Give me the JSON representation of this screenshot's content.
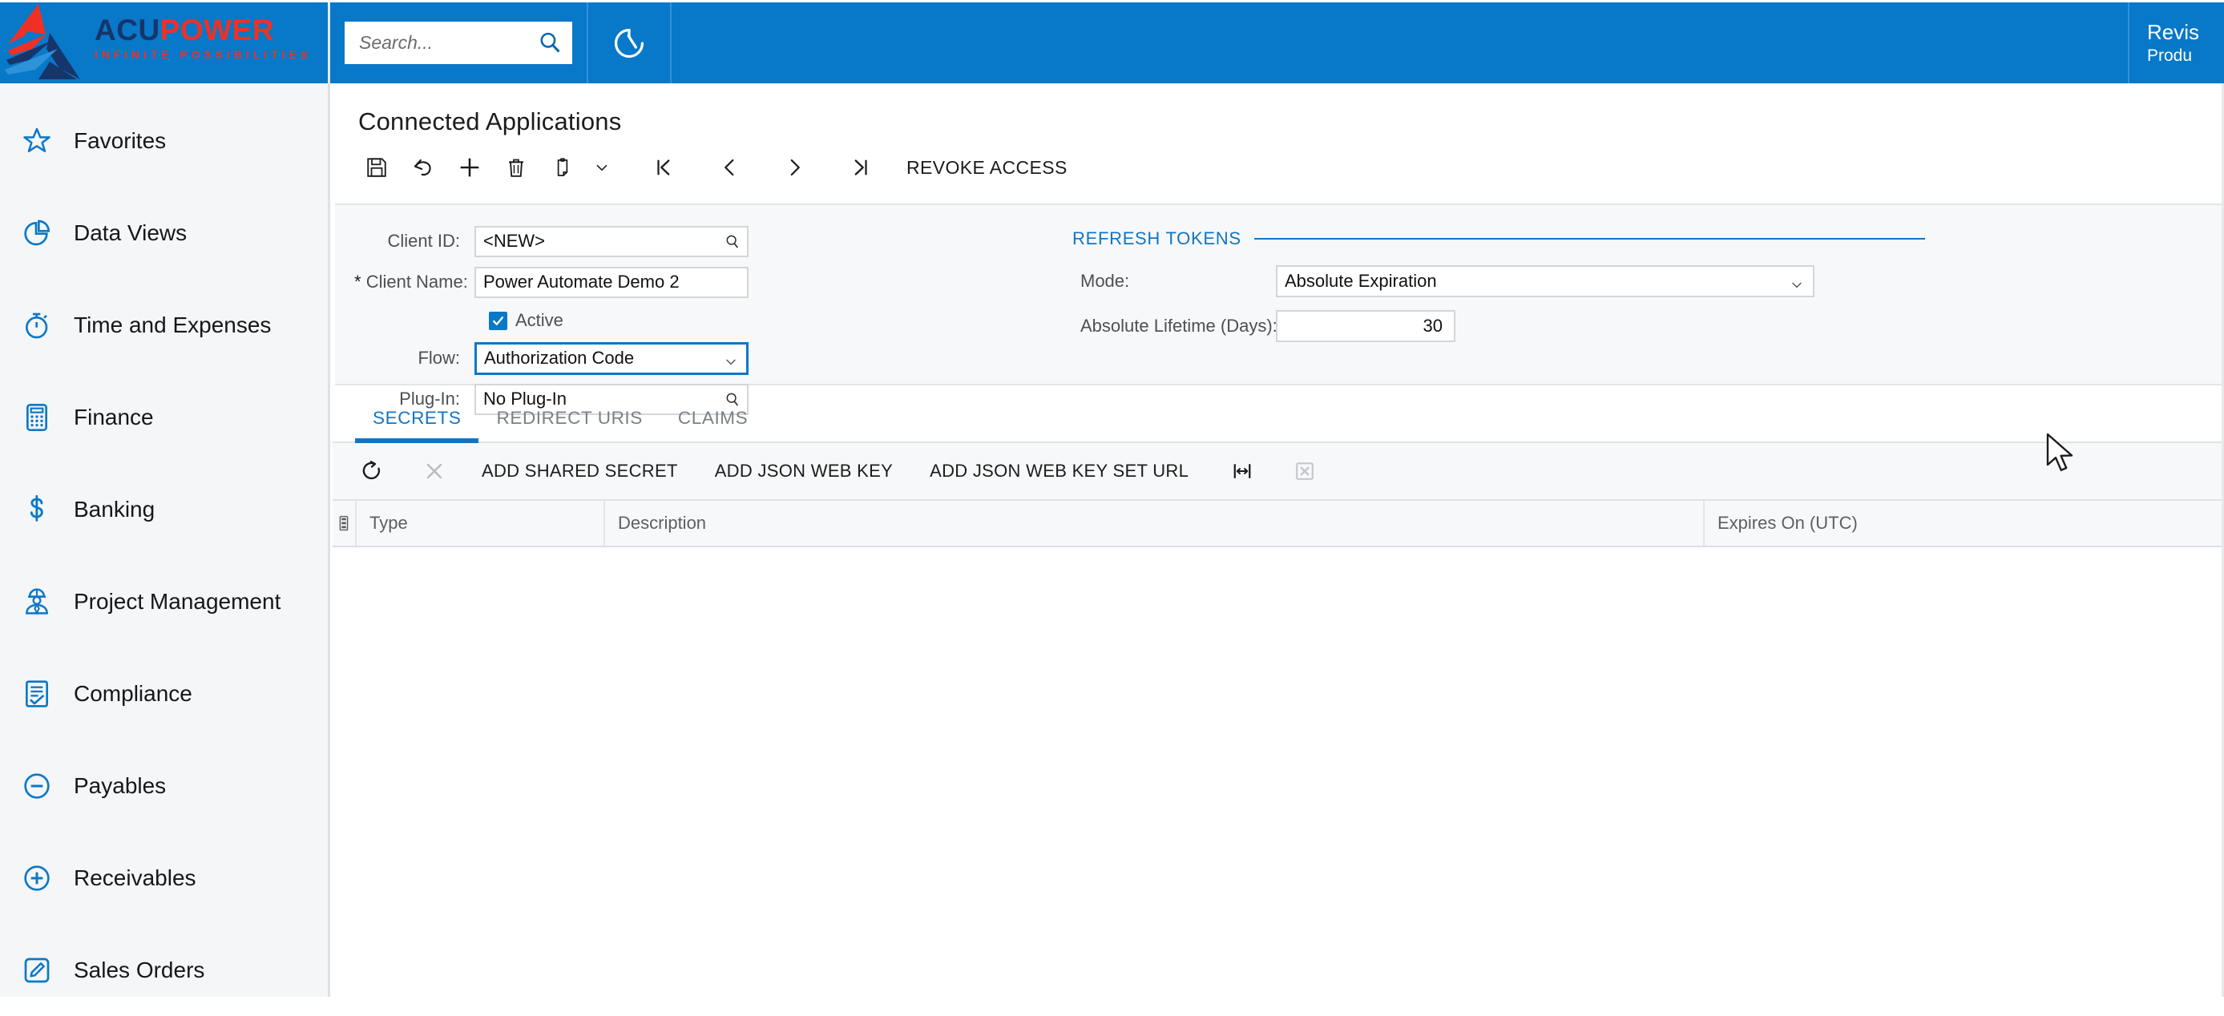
{
  "header": {
    "logo": {
      "word1": "ACU",
      "word2": "POWER",
      "tagline": "INFINITE POSSIBILITIES"
    },
    "search": {
      "placeholder": "Search...",
      "value": "",
      "icon": "search-icon"
    },
    "recent_icon": "history-clock-icon",
    "company": {
      "line1": "Revis",
      "line2": "Produ"
    }
  },
  "sidebar": {
    "items": [
      {
        "label": "Favorites",
        "icon": "star-icon"
      },
      {
        "label": "Data Views",
        "icon": "pie-chart-icon"
      },
      {
        "label": "Time and Expenses",
        "icon": "stopwatch-icon"
      },
      {
        "label": "Finance",
        "icon": "calculator-icon"
      },
      {
        "label": "Banking",
        "icon": "dollar-icon"
      },
      {
        "label": "Project Management",
        "icon": "worker-icon"
      },
      {
        "label": "Compliance",
        "icon": "checklist-icon"
      },
      {
        "label": "Payables",
        "icon": "minus-circle-icon"
      },
      {
        "label": "Receivables",
        "icon": "plus-circle-icon"
      },
      {
        "label": "Sales Orders",
        "icon": "pencil-square-icon"
      }
    ]
  },
  "page": {
    "title": "Connected Applications"
  },
  "toolbar": {
    "save": "save-icon",
    "undo": "undo-icon",
    "add": "plus-icon",
    "delete": "trash-icon",
    "clipboard": "clipboard-icon",
    "clipboard_caret": "chevron-down-icon",
    "first": "first-record-icon",
    "prev": "prev-record-icon",
    "next": "next-record-icon",
    "last": "last-record-icon",
    "revoke_label": "REVOKE ACCESS"
  },
  "form": {
    "client_id": {
      "label": "Client ID:",
      "value": "<NEW>",
      "icon": "magnifier-icon"
    },
    "client_name": {
      "label": "Client Name:",
      "required_mark": "*",
      "value": "Power Automate Demo 2"
    },
    "active": {
      "label": "Active",
      "checked": true
    },
    "flow": {
      "label": "Flow:",
      "value": "Authorization Code",
      "focused": true
    },
    "plugin": {
      "label": "Plug-In:",
      "value": "No Plug-In",
      "icon": "magnifier-icon"
    }
  },
  "refresh_tokens": {
    "section_title": "REFRESH TOKENS",
    "mode": {
      "label": "Mode:",
      "value": "Absolute Expiration"
    },
    "absolute_lifetime": {
      "label": "Absolute Lifetime (Days):",
      "value": "30"
    }
  },
  "tabs": [
    {
      "label": "SECRETS",
      "active": true
    },
    {
      "label": "REDIRECT URIS",
      "active": false
    },
    {
      "label": "CLAIMS",
      "active": false
    }
  ],
  "grid_toolbar": {
    "refresh": "refresh-icon",
    "cancel": "close-x-icon",
    "add_shared_secret": "ADD SHARED SECRET",
    "add_json_web_key": "ADD JSON WEB KEY",
    "add_json_web_key_set_url": "ADD JSON WEB KEY SET URL",
    "fit_columns": "fit-columns-icon",
    "export_excel": "export-excel-icon"
  },
  "grid": {
    "config_icon": "column-config-icon",
    "columns": [
      "Type",
      "Description",
      "Expires On (UTC)"
    ],
    "rows": []
  },
  "colors": {
    "header_blue": "#0878c8",
    "accent_blue": "#1375c2",
    "logo_navy": "#16356b",
    "logo_red": "#ee3124",
    "panel_bg": "#f7f8fa"
  }
}
